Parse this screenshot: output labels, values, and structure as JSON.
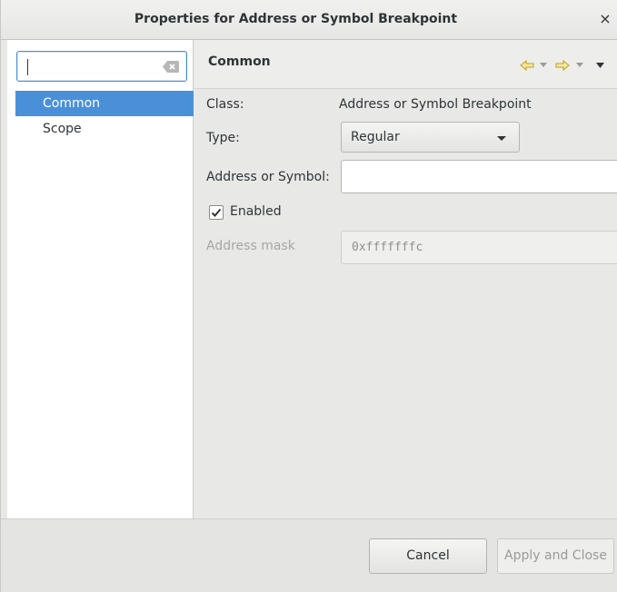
{
  "window": {
    "title": "Properties for Address or Symbol Breakpoint",
    "close_glyph": "×"
  },
  "sidebar": {
    "filter": {
      "value": "",
      "placeholder": ""
    },
    "items": [
      {
        "label": "Common",
        "selected": true
      },
      {
        "label": "Scope",
        "selected": false
      }
    ]
  },
  "page": {
    "title": "Common",
    "nav_icons": [
      "back-arrow-icon",
      "back-menu-icon",
      "forward-arrow-icon",
      "forward-menu-icon",
      "view-menu-icon"
    ],
    "class_label": "Class:",
    "class_value": "Address or Symbol Breakpoint",
    "type_label": "Type:",
    "type_value": "Regular",
    "address_label": "Address or Symbol:",
    "address_value": "",
    "enabled_label": "Enabled",
    "enabled_checked": true,
    "mask_label": "Address mask",
    "mask_value": "0xfffffffc"
  },
  "footer": {
    "cancel_label": "Cancel",
    "apply_label": "Apply and Close"
  },
  "colors": {
    "selection": "#4a90d9",
    "nav_arrow": "#c4a000",
    "background": "#e8e8e7"
  }
}
